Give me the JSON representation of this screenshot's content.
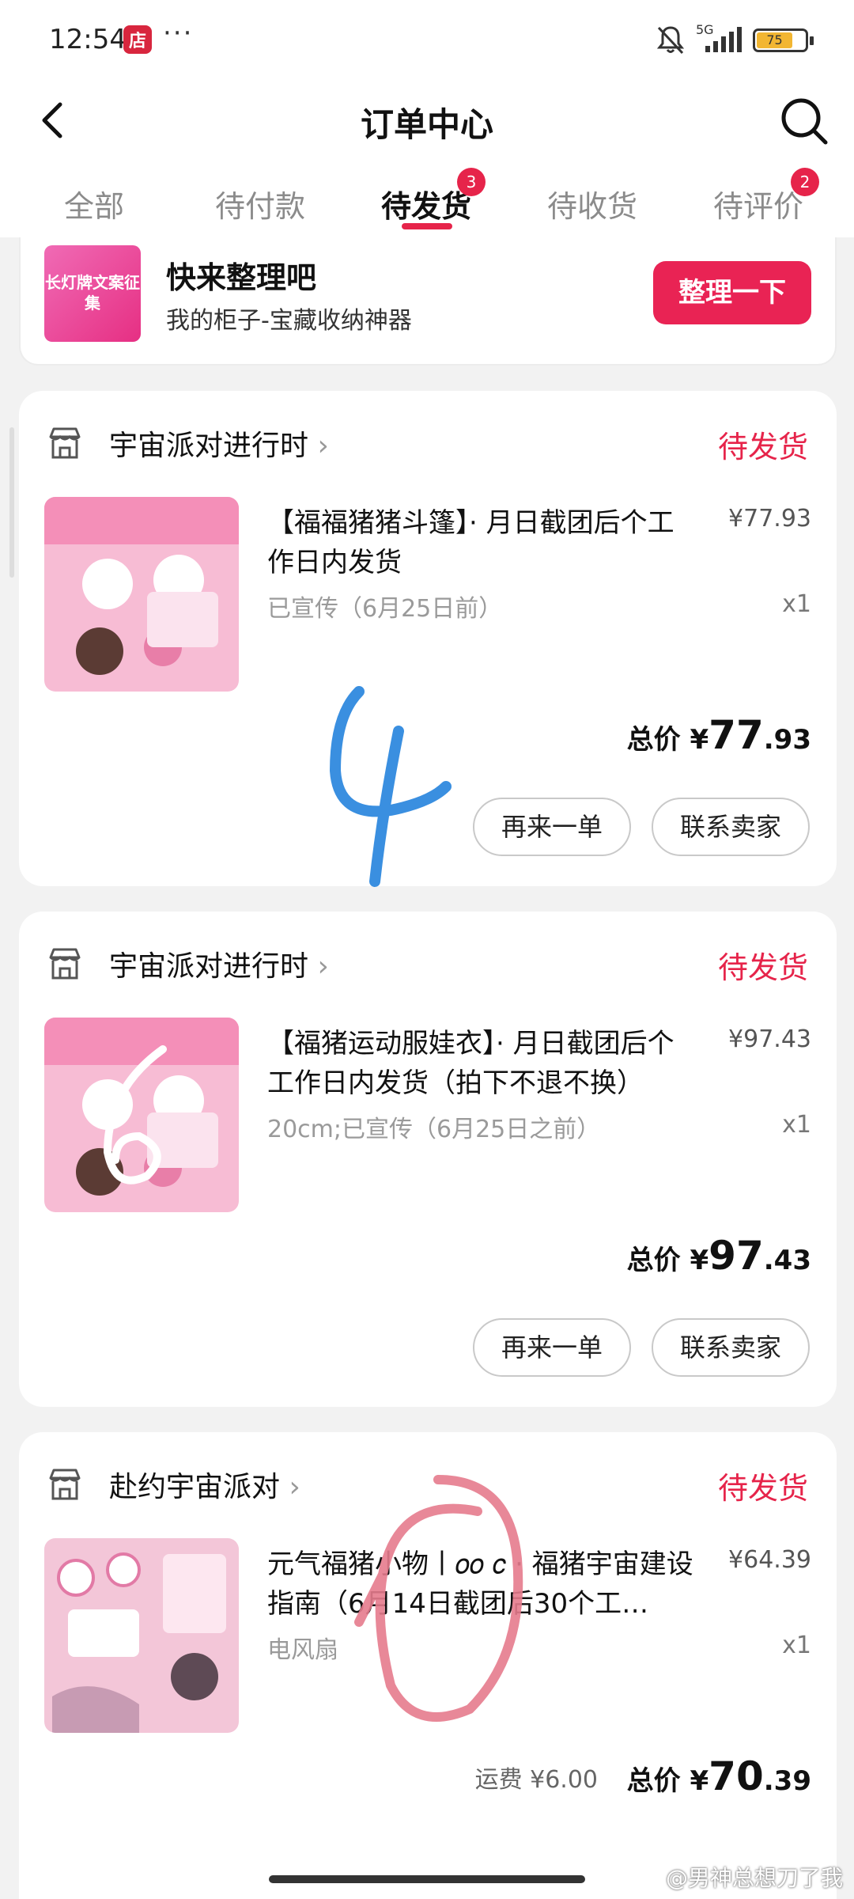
{
  "status_bar": {
    "time": "12:54",
    "app_badge": "店",
    "more_dots": "···",
    "network": "5G",
    "battery": "75"
  },
  "header": {
    "title": "订单中心"
  },
  "tabs": [
    {
      "label": "全部",
      "active": false,
      "badge": ""
    },
    {
      "label": "待付款",
      "active": false,
      "badge": ""
    },
    {
      "label": "待发货",
      "active": true,
      "badge": "3"
    },
    {
      "label": "待收货",
      "active": false,
      "badge": ""
    },
    {
      "label": "待评价",
      "active": false,
      "badge": "2"
    }
  ],
  "promo": {
    "thumb_text": "长灯牌文案征集",
    "title": "快来整理吧",
    "subtitle": "我的柜子-宝藏收纳神器",
    "button": "整理一下"
  },
  "orders": [
    {
      "shop": "宇宙派对进行时",
      "status": "待发货",
      "title": "【福福猪猪斗篷】· 月日截团后个工作日内发货",
      "spec": "已宣传（6月25日前）",
      "price": "¥77.93",
      "qty": "x1",
      "total_label": "总价 ¥",
      "total_int": "77",
      "total_dec": ".93",
      "shipping": "",
      "buttons": [
        "再来一单",
        "联系卖家"
      ]
    },
    {
      "shop": "宇宙派对进行时",
      "status": "待发货",
      "title": "【福猪运动服娃衣】· 月日截团后个工作日内发货（拍下不退不换）",
      "spec": "20cm;已宣传（6月25日之前）",
      "price": "¥97.43",
      "qty": "x1",
      "total_label": "总价 ¥",
      "total_int": "97",
      "total_dec": ".43",
      "shipping": "",
      "buttons": [
        "再来一单",
        "联系卖家"
      ]
    },
    {
      "shop": "赴约宇宙派对",
      "status": "待发货",
      "title": "元气福猪小物丨𝑜𝑜 𝑐 · 福猪宇宙建设指南（6月14日截团后30个工…",
      "spec": "电风扇",
      "price": "¥64.39",
      "qty": "x1",
      "total_label": "总价 ¥",
      "total_int": "70",
      "total_dec": ".39",
      "shipping": "运费 ¥6.00",
      "buttons": []
    }
  ],
  "watermark": "@男神总想刀了我",
  "colors": {
    "accent": "#e6244a",
    "button_pink": "#e92354"
  }
}
